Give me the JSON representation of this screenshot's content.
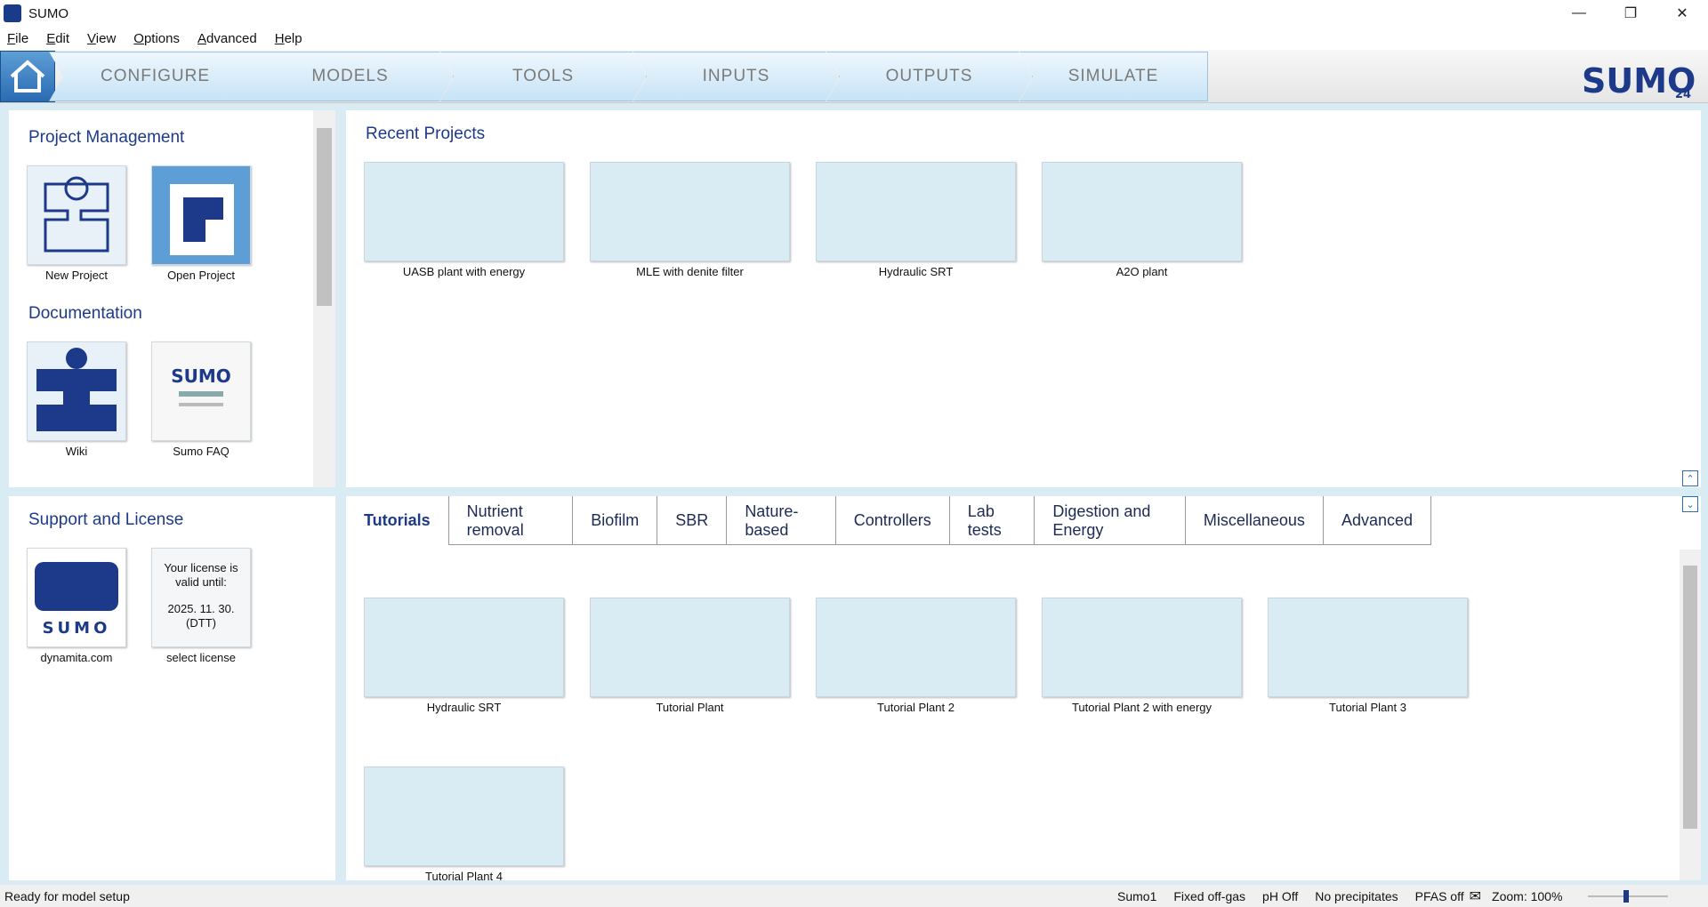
{
  "window": {
    "title": "SUMO",
    "controls": [
      "minimize",
      "restore",
      "close"
    ]
  },
  "menu": [
    {
      "label": "File",
      "key": "F",
      "rest": "ile"
    },
    {
      "label": "Edit",
      "key": "E",
      "rest": "dit"
    },
    {
      "label": "View",
      "key": "V",
      "rest": "iew"
    },
    {
      "label": "Options",
      "key": "O",
      "rest": "ptions"
    },
    {
      "label": "Advanced",
      "key": "A",
      "rest": "dvanced"
    },
    {
      "label": "Help",
      "key": "H",
      "rest": "elp"
    }
  ],
  "nav": {
    "home_icon": "home-icon",
    "tabs": [
      "CONFIGURE",
      "MODELS",
      "TOOLS",
      "INPUTS",
      "OUTPUTS",
      "SIMULATE"
    ],
    "logo_text": "SUMO",
    "logo_version": "24"
  },
  "project_management": {
    "title": "Project Management",
    "items": [
      {
        "label": "New Project",
        "icon": "new-project-icon"
      },
      {
        "label": "Open Project",
        "icon": "open-project-icon"
      }
    ]
  },
  "documentation": {
    "title": "Documentation",
    "items": [
      {
        "label": "Wiki",
        "icon": "wiki-icon"
      },
      {
        "label": "Sumo FAQ",
        "icon": "faq-icon"
      }
    ]
  },
  "support": {
    "title": "Support and License",
    "items": [
      {
        "label": "dynamita.com",
        "icon": "dynamita-logo"
      },
      {
        "label": "select license",
        "text_line1": "Your license is",
        "text_line2": "valid until:",
        "text_line3": "2025. 11. 30.",
        "text_line4": "(DTT)"
      }
    ]
  },
  "recent": {
    "title": "Recent Projects",
    "items": [
      "UASB plant with energy",
      "MLE with denite filter",
      "Hydraulic SRT",
      "A2O plant"
    ]
  },
  "examples": {
    "tabs": [
      "Tutorials",
      "Nutrient removal",
      "Biofilm",
      "SBR",
      "Nature-based",
      "Controllers",
      "Lab tests",
      "Digestion and Energy",
      "Miscellaneous",
      "Advanced"
    ],
    "active_tab": "Tutorials",
    "items": [
      "Hydraulic SRT",
      "Tutorial Plant",
      "Tutorial Plant 2",
      "Tutorial Plant 2 with energy",
      "Tutorial Plant 3",
      "Tutorial Plant 4"
    ]
  },
  "status": {
    "message": "Ready for model setup",
    "indicators": [
      "Sumo1",
      "Fixed off-gas",
      "pH Off",
      "No precipitates",
      "PFAS off"
    ],
    "zoom": "Zoom: 100%",
    "zoom_value": 100
  },
  "colors": {
    "accent": "#1d3a8a",
    "background": "#d9ecf4",
    "tab_fill": "#c7e3f6"
  }
}
